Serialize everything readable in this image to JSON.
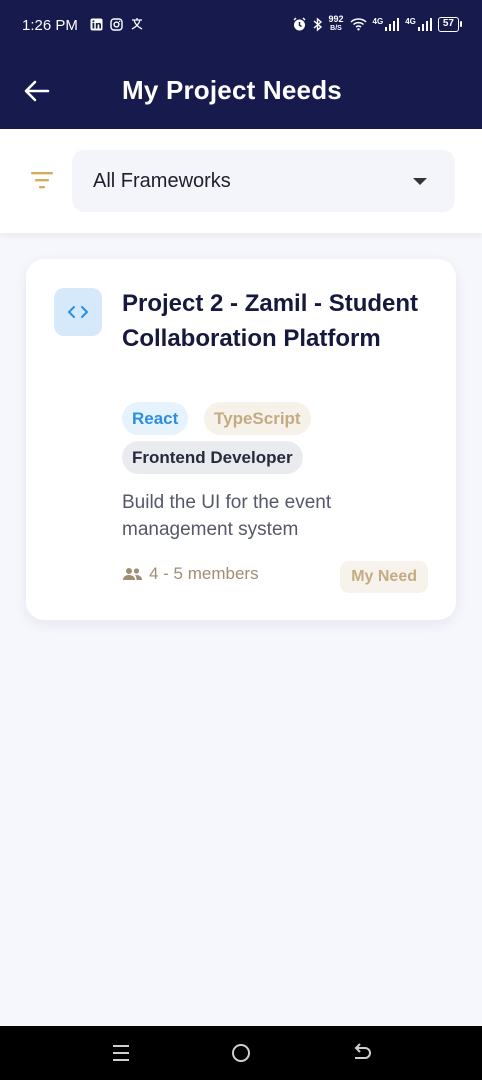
{
  "status_bar": {
    "time": "1:26 PM",
    "net_speed_value": "992",
    "net_speed_unit": "B/S",
    "network_1": "4G",
    "network_2": "4G",
    "battery": "57"
  },
  "app_bar": {
    "title": "My Project Needs",
    "background": "#161a4d"
  },
  "filter": {
    "selected_framework": "All Frameworks",
    "icon_color": "#d7a95a"
  },
  "projects": [
    {
      "title": "Project 2 - Zamil - Student Collaboration Platform",
      "icon": "code-icon",
      "tags": [
        "React",
        "TypeScript"
      ],
      "role": "Frontend Developer",
      "description": "Build the UI for the event management system",
      "members": "4 - 5 members",
      "status_badge": "My Need"
    }
  ],
  "nav_bar": {
    "buttons": [
      "recent-apps-icon",
      "home-icon",
      "back-nav-icon"
    ]
  }
}
